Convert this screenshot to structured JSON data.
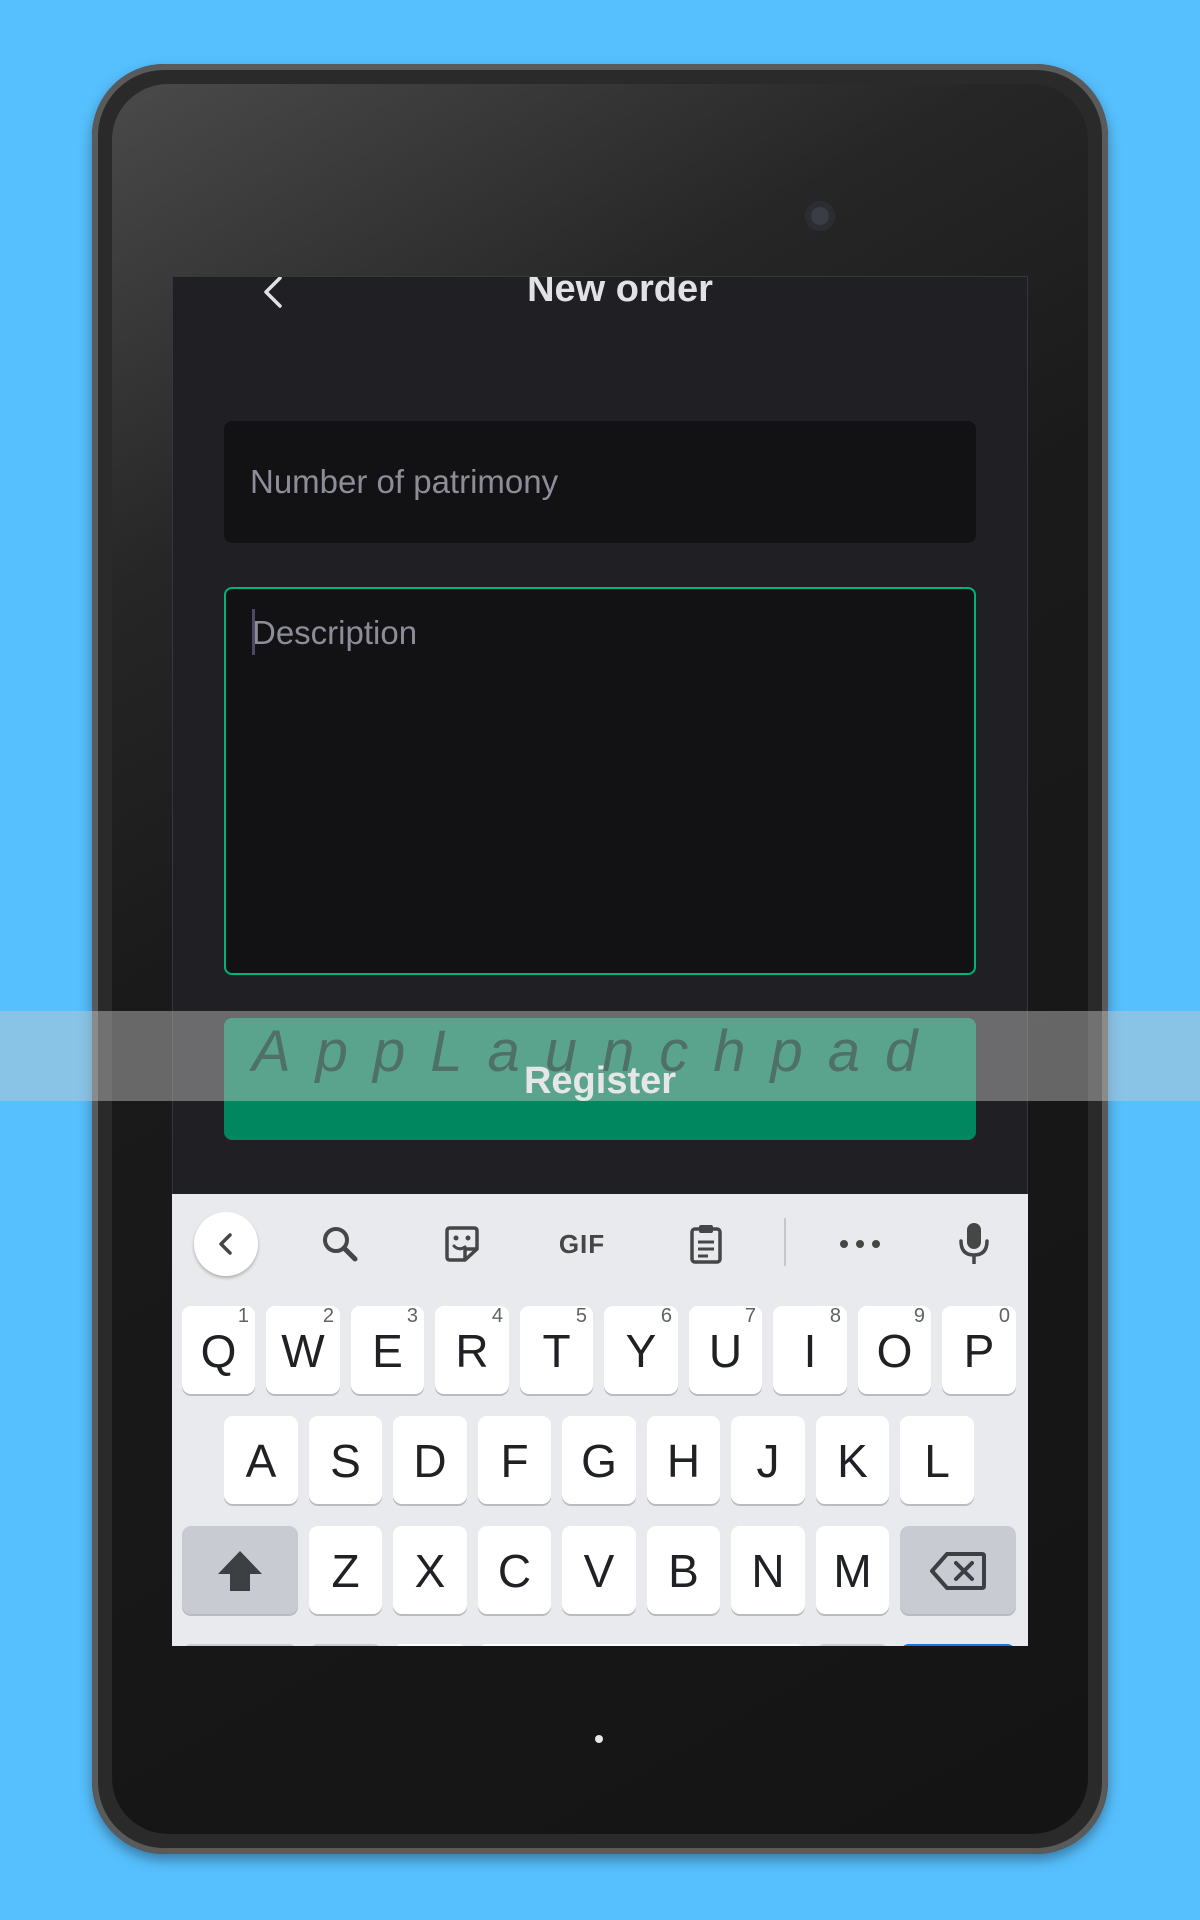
{
  "header": {
    "title": "New order"
  },
  "form": {
    "patrimony_placeholder": "Number of patrimony",
    "description_placeholder": "Description",
    "register_label": "Register"
  },
  "keyboard": {
    "toolbar": {
      "gif_label": "GIF"
    },
    "row1": [
      {
        "letter": "Q",
        "hint": "1"
      },
      {
        "letter": "W",
        "hint": "2"
      },
      {
        "letter": "E",
        "hint": "3"
      },
      {
        "letter": "R",
        "hint": "4"
      },
      {
        "letter": "T",
        "hint": "5"
      },
      {
        "letter": "Y",
        "hint": "6"
      },
      {
        "letter": "U",
        "hint": "7"
      },
      {
        "letter": "I",
        "hint": "8"
      },
      {
        "letter": "O",
        "hint": "9"
      },
      {
        "letter": "P",
        "hint": "0"
      }
    ],
    "row2": [
      "A",
      "S",
      "D",
      "F",
      "G",
      "H",
      "J",
      "K",
      "L"
    ],
    "row3": [
      "Z",
      "X",
      "C",
      "V",
      "B",
      "N",
      "M"
    ]
  },
  "watermark": {
    "text": "AppLaunchpad"
  },
  "colors": {
    "background": "#56bffd",
    "screen_bg": "#202024",
    "input_bg": "#121214",
    "accent_green": "#00b37e",
    "button_green": "#00875f",
    "keyboard_bg": "#e8eaed"
  }
}
